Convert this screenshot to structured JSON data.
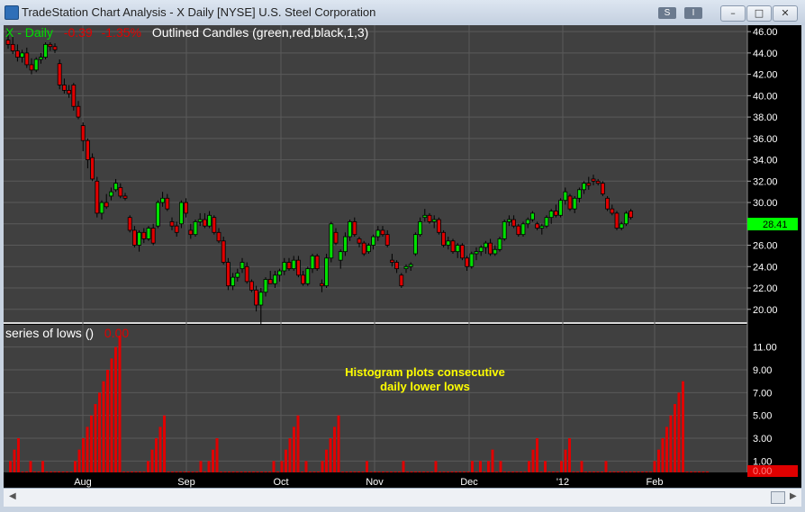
{
  "window": {
    "title": "TradeStation Chart Analysis - X Daily [NYSE] U.S. Steel Corporation",
    "btn_s": "S",
    "btn_i": "I"
  },
  "colors": {
    "background": "#404040",
    "grid": "#5a5a5a",
    "up": "#00e000",
    "down": "#e00000",
    "outline": "#000000",
    "hist": "#e00000",
    "annotation": "#ffff00",
    "last_price_bg": "#00ff00"
  },
  "price_panel": {
    "symbol_label": "X - Daily",
    "change": "-0.39",
    "change_pct": "-1.35%",
    "study_label": "Outlined Candles (green,red,black,1,3)",
    "last_price": "28.41",
    "axis_ticks": [
      "46.00",
      "44.00",
      "42.00",
      "40.00",
      "38.00",
      "36.00",
      "34.00",
      "32.00",
      "30.00",
      "28.00",
      "26.00",
      "24.00",
      "22.00",
      "20.00"
    ]
  },
  "indicator_panel": {
    "label": "series of lows ()",
    "value": "0.00",
    "last_value": "0.00",
    "axis_ticks": [
      "11.00",
      "9.00",
      "7.00",
      "5.00",
      "3.00",
      "1.00"
    ],
    "annotation_line1": "Histogram plots consecutive",
    "annotation_line2": "daily lower lows"
  },
  "x_axis": {
    "labels": [
      "Aug",
      "Sep",
      "Oct",
      "Nov",
      "Dec",
      "'12",
      "Feb"
    ]
  },
  "chart_data": {
    "type": "candlestick+histogram",
    "candles": [
      {
        "o": 45.2,
        "h": 46.2,
        "l": 44.4,
        "c": 44.8
      },
      {
        "o": 44.8,
        "h": 45.5,
        "l": 43.9,
        "c": 44.2
      },
      {
        "o": 44.2,
        "h": 44.8,
        "l": 43.2,
        "c": 43.6
      },
      {
        "o": 43.6,
        "h": 44.3,
        "l": 43.1,
        "c": 44.0
      },
      {
        "o": 44.0,
        "h": 44.5,
        "l": 42.6,
        "c": 42.9
      },
      {
        "o": 42.9,
        "h": 43.5,
        "l": 42.0,
        "c": 42.4
      },
      {
        "o": 42.4,
        "h": 43.6,
        "l": 42.2,
        "c": 43.4
      },
      {
        "o": 43.4,
        "h": 44.0,
        "l": 43.0,
        "c": 43.6
      },
      {
        "o": 43.6,
        "h": 45.0,
        "l": 43.4,
        "c": 44.8
      },
      {
        "o": 44.8,
        "h": 45.0,
        "l": 44.2,
        "c": 44.6
      },
      {
        "o": 44.6,
        "h": 44.9,
        "l": 44.0,
        "c": 44.3
      },
      {
        "o": 43.0,
        "h": 43.4,
        "l": 40.6,
        "c": 41.0
      },
      {
        "o": 41.0,
        "h": 41.6,
        "l": 40.2,
        "c": 40.5
      },
      {
        "o": 40.5,
        "h": 41.0,
        "l": 39.8,
        "c": 40.2
      },
      {
        "o": 41.0,
        "h": 41.2,
        "l": 38.6,
        "c": 39.0
      },
      {
        "o": 39.0,
        "h": 39.5,
        "l": 37.8,
        "c": 38.0
      },
      {
        "o": 37.2,
        "h": 37.5,
        "l": 34.8,
        "c": 35.8
      },
      {
        "o": 35.8,
        "h": 36.0,
        "l": 33.2,
        "c": 34.0
      },
      {
        "o": 34.2,
        "h": 34.6,
        "l": 32.0,
        "c": 32.2
      },
      {
        "o": 32.0,
        "h": 32.4,
        "l": 28.6,
        "c": 29.0
      },
      {
        "o": 29.0,
        "h": 30.2,
        "l": 28.4,
        "c": 30.0
      },
      {
        "o": 30.0,
        "h": 30.8,
        "l": 29.4,
        "c": 29.6
      },
      {
        "o": 30.6,
        "h": 31.4,
        "l": 30.2,
        "c": 31.0
      },
      {
        "o": 31.2,
        "h": 32.2,
        "l": 31.0,
        "c": 31.8
      },
      {
        "o": 31.4,
        "h": 31.8,
        "l": 30.4,
        "c": 30.6
      },
      {
        "o": 30.6,
        "h": 30.9,
        "l": 30.2,
        "c": 30.4
      },
      {
        "o": 28.6,
        "h": 28.8,
        "l": 27.2,
        "c": 27.4
      },
      {
        "o": 27.4,
        "h": 27.8,
        "l": 25.8,
        "c": 26.0
      },
      {
        "o": 26.0,
        "h": 27.4,
        "l": 25.4,
        "c": 27.2
      },
      {
        "o": 27.2,
        "h": 27.6,
        "l": 26.2,
        "c": 26.6
      },
      {
        "o": 26.6,
        "h": 27.8,
        "l": 26.4,
        "c": 27.6
      },
      {
        "o": 27.6,
        "h": 28.0,
        "l": 26.0,
        "c": 26.2
      },
      {
        "o": 27.8,
        "h": 30.2,
        "l": 27.6,
        "c": 30.0
      },
      {
        "o": 30.0,
        "h": 31.0,
        "l": 29.6,
        "c": 30.4
      },
      {
        "o": 30.4,
        "h": 30.8,
        "l": 29.2,
        "c": 29.4
      },
      {
        "o": 28.2,
        "h": 28.6,
        "l": 27.4,
        "c": 27.8
      },
      {
        "o": 27.8,
        "h": 28.2,
        "l": 26.8,
        "c": 27.2
      },
      {
        "o": 28.0,
        "h": 30.2,
        "l": 27.6,
        "c": 30.0
      },
      {
        "o": 30.0,
        "h": 30.4,
        "l": 28.6,
        "c": 29.0
      },
      {
        "o": 27.4,
        "h": 28.0,
        "l": 26.6,
        "c": 27.0
      },
      {
        "o": 27.0,
        "h": 28.4,
        "l": 26.8,
        "c": 28.2
      },
      {
        "o": 28.2,
        "h": 29.0,
        "l": 27.8,
        "c": 28.4
      },
      {
        "o": 28.4,
        "h": 29.0,
        "l": 27.6,
        "c": 27.8
      },
      {
        "o": 27.8,
        "h": 29.2,
        "l": 27.6,
        "c": 28.8
      },
      {
        "o": 28.6,
        "h": 28.8,
        "l": 27.0,
        "c": 27.2
      },
      {
        "o": 27.2,
        "h": 27.6,
        "l": 26.2,
        "c": 26.4
      },
      {
        "o": 26.4,
        "h": 26.8,
        "l": 24.2,
        "c": 24.4
      },
      {
        "o": 24.4,
        "h": 24.8,
        "l": 21.8,
        "c": 22.2
      },
      {
        "o": 22.2,
        "h": 23.4,
        "l": 21.8,
        "c": 23.0
      },
      {
        "o": 23.0,
        "h": 23.8,
        "l": 22.6,
        "c": 23.4
      },
      {
        "o": 23.8,
        "h": 24.8,
        "l": 23.4,
        "c": 24.4
      },
      {
        "o": 24.0,
        "h": 24.4,
        "l": 22.4,
        "c": 22.6
      },
      {
        "o": 22.6,
        "h": 22.8,
        "l": 21.6,
        "c": 21.8
      },
      {
        "o": 21.8,
        "h": 22.2,
        "l": 19.8,
        "c": 20.4
      },
      {
        "o": 20.4,
        "h": 22.0,
        "l": 18.6,
        "c": 21.6
      },
      {
        "o": 21.6,
        "h": 23.0,
        "l": 21.2,
        "c": 22.8
      },
      {
        "o": 22.8,
        "h": 23.6,
        "l": 22.4,
        "c": 22.4
      },
      {
        "o": 22.4,
        "h": 23.6,
        "l": 22.0,
        "c": 23.2
      },
      {
        "o": 23.2,
        "h": 23.8,
        "l": 22.6,
        "c": 23.6
      },
      {
        "o": 23.6,
        "h": 24.8,
        "l": 23.2,
        "c": 24.4
      },
      {
        "o": 24.4,
        "h": 24.8,
        "l": 23.6,
        "c": 23.8
      },
      {
        "o": 23.8,
        "h": 25.0,
        "l": 23.6,
        "c": 24.6
      },
      {
        "o": 24.6,
        "h": 25.0,
        "l": 23.0,
        "c": 23.2
      },
      {
        "o": 23.2,
        "h": 23.6,
        "l": 22.2,
        "c": 22.4
      },
      {
        "o": 22.4,
        "h": 24.0,
        "l": 22.2,
        "c": 23.8
      },
      {
        "o": 23.8,
        "h": 25.2,
        "l": 23.4,
        "c": 25.0
      },
      {
        "o": 25.0,
        "h": 25.2,
        "l": 23.6,
        "c": 23.8
      },
      {
        "o": 22.4,
        "h": 22.8,
        "l": 21.6,
        "c": 22.2
      },
      {
        "o": 22.2,
        "h": 25.2,
        "l": 22.0,
        "c": 24.8
      },
      {
        "o": 24.8,
        "h": 28.2,
        "l": 24.4,
        "c": 28.0
      },
      {
        "o": 27.2,
        "h": 27.6,
        "l": 26.0,
        "c": 26.2
      },
      {
        "o": 24.6,
        "h": 25.6,
        "l": 23.8,
        "c": 25.4
      },
      {
        "o": 25.4,
        "h": 27.2,
        "l": 25.0,
        "c": 26.8
      },
      {
        "o": 26.8,
        "h": 28.4,
        "l": 26.4,
        "c": 28.2
      },
      {
        "o": 28.2,
        "h": 28.6,
        "l": 26.8,
        "c": 27.0
      },
      {
        "o": 26.6,
        "h": 26.8,
        "l": 25.8,
        "c": 26.2
      },
      {
        "o": 26.2,
        "h": 26.4,
        "l": 25.0,
        "c": 25.2
      },
      {
        "o": 25.4,
        "h": 26.2,
        "l": 25.2,
        "c": 26.0
      },
      {
        "o": 26.0,
        "h": 27.0,
        "l": 25.6,
        "c": 26.8
      },
      {
        "o": 26.8,
        "h": 27.8,
        "l": 26.4,
        "c": 27.4
      },
      {
        "o": 27.4,
        "h": 27.8,
        "l": 26.8,
        "c": 27.0
      },
      {
        "o": 27.0,
        "h": 27.4,
        "l": 25.8,
        "c": 26.0
      },
      {
        "o": 24.6,
        "h": 25.2,
        "l": 24.0,
        "c": 24.4
      },
      {
        "o": 24.4,
        "h": 24.6,
        "l": 23.4,
        "c": 23.8
      },
      {
        "o": 23.2,
        "h": 23.4,
        "l": 22.0,
        "c": 22.2
      },
      {
        "o": 23.8,
        "h": 24.2,
        "l": 23.4,
        "c": 24.0
      },
      {
        "o": 24.0,
        "h": 24.4,
        "l": 23.6,
        "c": 24.2
      },
      {
        "o": 25.2,
        "h": 27.2,
        "l": 25.0,
        "c": 27.0
      },
      {
        "o": 27.0,
        "h": 28.6,
        "l": 26.8,
        "c": 28.2
      },
      {
        "o": 28.6,
        "h": 29.4,
        "l": 28.2,
        "c": 28.8
      },
      {
        "o": 28.8,
        "h": 29.0,
        "l": 28.0,
        "c": 28.2
      },
      {
        "o": 28.2,
        "h": 28.8,
        "l": 27.6,
        "c": 28.4
      },
      {
        "o": 28.4,
        "h": 28.6,
        "l": 27.0,
        "c": 27.2
      },
      {
        "o": 27.2,
        "h": 27.4,
        "l": 25.8,
        "c": 26.0
      },
      {
        "o": 26.0,
        "h": 26.8,
        "l": 25.6,
        "c": 26.4
      },
      {
        "o": 26.4,
        "h": 26.6,
        "l": 25.2,
        "c": 25.4
      },
      {
        "o": 25.4,
        "h": 26.2,
        "l": 24.8,
        "c": 26.0
      },
      {
        "o": 26.0,
        "h": 26.2,
        "l": 24.6,
        "c": 24.8
      },
      {
        "o": 24.8,
        "h": 25.0,
        "l": 23.6,
        "c": 24.0
      },
      {
        "o": 24.0,
        "h": 25.4,
        "l": 23.8,
        "c": 25.2
      },
      {
        "o": 25.2,
        "h": 25.8,
        "l": 24.6,
        "c": 25.4
      },
      {
        "o": 25.4,
        "h": 26.0,
        "l": 25.0,
        "c": 25.8
      },
      {
        "o": 25.8,
        "h": 26.4,
        "l": 25.2,
        "c": 26.2
      },
      {
        "o": 26.2,
        "h": 26.6,
        "l": 25.0,
        "c": 25.2
      },
      {
        "o": 25.2,
        "h": 26.0,
        "l": 25.0,
        "c": 25.6
      },
      {
        "o": 25.6,
        "h": 26.8,
        "l": 25.4,
        "c": 26.6
      },
      {
        "o": 26.6,
        "h": 28.4,
        "l": 26.4,
        "c": 28.2
      },
      {
        "o": 28.2,
        "h": 28.8,
        "l": 27.8,
        "c": 28.4
      },
      {
        "o": 28.4,
        "h": 28.8,
        "l": 27.6,
        "c": 27.8
      },
      {
        "o": 27.8,
        "h": 28.0,
        "l": 26.8,
        "c": 27.0
      },
      {
        "o": 27.0,
        "h": 28.2,
        "l": 26.8,
        "c": 28.0
      },
      {
        "o": 28.0,
        "h": 28.6,
        "l": 27.6,
        "c": 28.4
      },
      {
        "o": 28.4,
        "h": 29.2,
        "l": 28.2,
        "c": 29.0
      },
      {
        "o": 28.0,
        "h": 28.2,
        "l": 27.4,
        "c": 27.6
      },
      {
        "o": 27.6,
        "h": 28.0,
        "l": 27.0,
        "c": 27.8
      },
      {
        "o": 27.8,
        "h": 28.8,
        "l": 27.6,
        "c": 28.6
      },
      {
        "o": 28.6,
        "h": 29.4,
        "l": 28.0,
        "c": 29.2
      },
      {
        "o": 29.2,
        "h": 29.8,
        "l": 28.6,
        "c": 28.8
      },
      {
        "o": 28.8,
        "h": 30.4,
        "l": 28.6,
        "c": 30.2
      },
      {
        "o": 30.2,
        "h": 31.4,
        "l": 29.8,
        "c": 31.0
      },
      {
        "o": 30.6,
        "h": 30.8,
        "l": 29.2,
        "c": 29.4
      },
      {
        "o": 29.4,
        "h": 30.6,
        "l": 29.0,
        "c": 30.4
      },
      {
        "o": 30.4,
        "h": 31.4,
        "l": 30.0,
        "c": 31.2
      },
      {
        "o": 31.2,
        "h": 32.0,
        "l": 30.8,
        "c": 31.8
      },
      {
        "o": 31.8,
        "h": 32.4,
        "l": 31.2,
        "c": 31.6
      },
      {
        "o": 32.2,
        "h": 32.6,
        "l": 31.6,
        "c": 32.0
      },
      {
        "o": 32.0,
        "h": 32.2,
        "l": 31.6,
        "c": 31.8
      },
      {
        "o": 31.8,
        "h": 32.0,
        "l": 30.6,
        "c": 30.8
      },
      {
        "o": 30.4,
        "h": 30.6,
        "l": 29.2,
        "c": 29.4
      },
      {
        "o": 29.4,
        "h": 29.8,
        "l": 28.8,
        "c": 29.0
      },
      {
        "o": 29.0,
        "h": 29.2,
        "l": 27.4,
        "c": 27.6
      },
      {
        "o": 27.6,
        "h": 28.2,
        "l": 27.4,
        "c": 28.0
      },
      {
        "o": 28.0,
        "h": 29.2,
        "l": 27.8,
        "c": 29.0
      },
      {
        "o": 29.2,
        "h": 29.4,
        "l": 28.4,
        "c": 28.6
      }
    ],
    "histogram": [
      1,
      2,
      3,
      0,
      0,
      1,
      0,
      0,
      1,
      0,
      0,
      0,
      0,
      0,
      0,
      0,
      1,
      2,
      3,
      4,
      5,
      6,
      7,
      8,
      9,
      10,
      11,
      12,
      0,
      0,
      0,
      0,
      0,
      0,
      1,
      2,
      3,
      4,
      5,
      0,
      0,
      0,
      0,
      0,
      0,
      0,
      0,
      1,
      0,
      1,
      2,
      3,
      0,
      0,
      0,
      0,
      0,
      0,
      0,
      0,
      0,
      0,
      0,
      0,
      0,
      1,
      0,
      1,
      2,
      3,
      4,
      5,
      0,
      1,
      0,
      0,
      0,
      1,
      2,
      3,
      4,
      5,
      0,
      0,
      0,
      0,
      0,
      0,
      1,
      0,
      0,
      0,
      0,
      0,
      0,
      0,
      0,
      1,
      0,
      0,
      0,
      0,
      0,
      0,
      0,
      1,
      0,
      0,
      0,
      0,
      0,
      0,
      0,
      0,
      1,
      0,
      1,
      0,
      1,
      2,
      0,
      1,
      0,
      0,
      0,
      0,
      0,
      0,
      1,
      2,
      3,
      0,
      1,
      0,
      0,
      0,
      1,
      2,
      3,
      0,
      0,
      1,
      0,
      0,
      0,
      0,
      0,
      1,
      0,
      0,
      0,
      0,
      0,
      0,
      0,
      0,
      0,
      0,
      0,
      1,
      2,
      3,
      4,
      5,
      6,
      7,
      8,
      0,
      0,
      0,
      0,
      0,
      0
    ],
    "ylim_price": [
      18.8,
      46.6
    ],
    "ylim_hist": [
      0,
      12
    ]
  }
}
